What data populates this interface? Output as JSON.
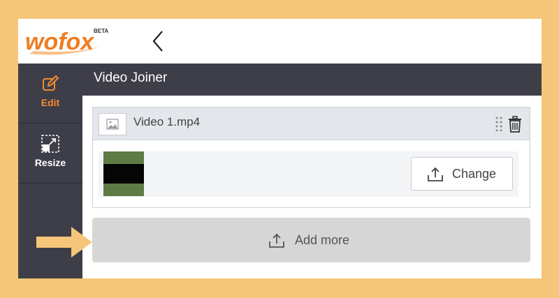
{
  "brand": {
    "logo_text": "wofox",
    "logo_badge": "BETA",
    "accent_color": "#f28d2e",
    "dark_color": "#3e3e49",
    "frame_color": "#f5c679"
  },
  "topbar": {
    "back_icon": "chevron-left-icon"
  },
  "sidebar": {
    "items": [
      {
        "label": "Edit",
        "icon": "edit-icon",
        "active": true
      },
      {
        "label": "Resize",
        "icon": "resize-icon",
        "active": false
      }
    ]
  },
  "annotation": {
    "icon": "arrow-right-icon",
    "color": "#f5c679"
  },
  "main": {
    "title": "Video Joiner",
    "videos": [
      {
        "file_name": "Video 1.mp4",
        "change_label": "Change",
        "placeholder_icon": "image-icon",
        "drag_icon": "drag-handle-icon",
        "delete_icon": "trash-icon",
        "upload_icon": "upload-icon"
      }
    ],
    "add_more_label": "Add more"
  }
}
